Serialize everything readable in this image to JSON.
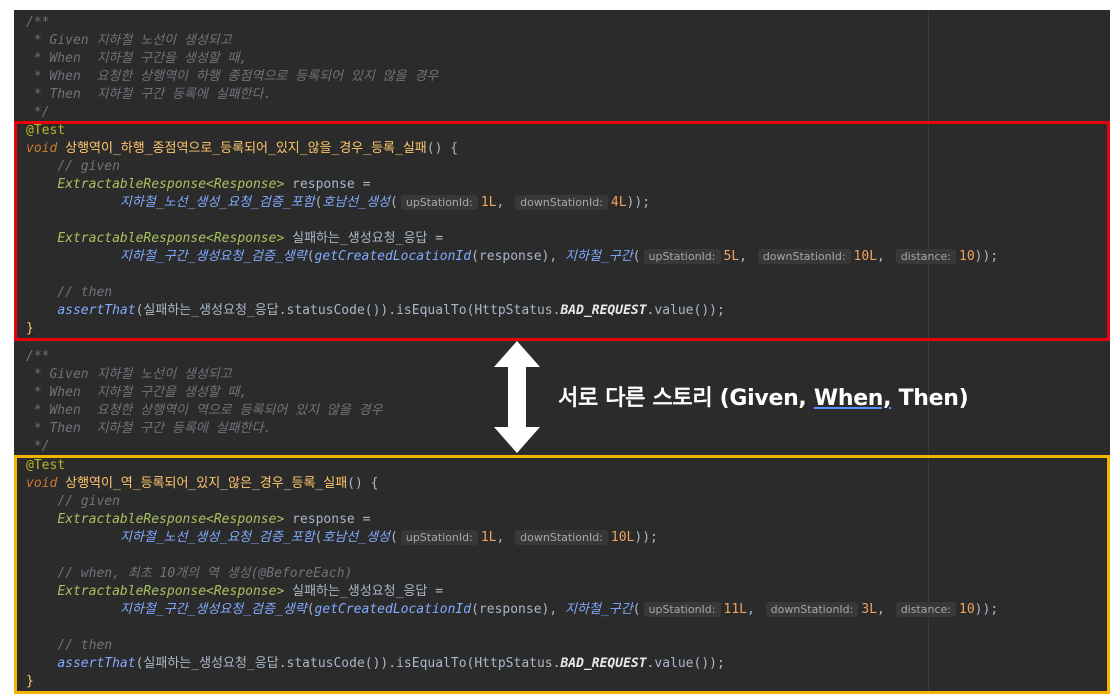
{
  "block1": {
    "doc": [
      "/**",
      " * Given 지하철 노선이 생성되고",
      " * When  지하철 구간을 생성할 때,",
      " * When  요청한 상행역이 하행 종점역으로 등록되어 있지 않을 경우",
      " * Then  지하철 구간 등록에 실패한다.",
      " */"
    ],
    "annotation": "@Test",
    "kw_void": "void",
    "method": "상행역이_하행_종점역으로_등록되어_있지_않을_경우_등록_실패",
    "sig_end": "() {",
    "c_given": "// given",
    "type1": "ExtractableResponse<Response>",
    "var1": " response =",
    "call1": "지하철_노선_생성_요청_검증_포함",
    "call1_inner": "호남선_생성",
    "h_up": "upStationId:",
    "v_up": "1L",
    "h_down": "downStationId:",
    "v_down": "4L",
    "type2": "ExtractableResponse<Response>",
    "var2": " 실패하는_생성요청_응답 =",
    "call2": "지하철_구간_생성요청_검증_생략",
    "call2_inner": "getCreatedLocationId",
    "arg_response": "response",
    "call2b": "지하철_구간",
    "h_up2": "upStationId:",
    "v_up2": "5L",
    "h_down2": "downStationId:",
    "v_down2": "10L",
    "h_dist": "distance:",
    "v_dist": "10",
    "c_then": "// then",
    "assert": "assertThat",
    "assert_arg": "실패하는_생성요청_응답",
    "status": ".statusCode()).isEqualTo(",
    "http": "HttpStatus.",
    "bad": "BAD_REQUEST",
    "val": ".value());",
    "close": "}"
  },
  "block2": {
    "doc": [
      "/**",
      " * Given 지하철 노선이 생성되고",
      " * When  지하철 구간을 생성할 때,",
      " * When  요청한 상행역이 역으로 등록되어 있지 않을 경우",
      " * Then  지하철 구간 등록에 실패한다.",
      " */"
    ],
    "annotation": "@Test",
    "kw_void": "void",
    "method": "상행역이_역_등록되어_있지_않은_경우_등록_실패",
    "sig_end": "() {",
    "c_given": "// given",
    "type1": "ExtractableResponse<Response>",
    "var1": " response =",
    "call1": "지하철_노선_생성_요청_검증_포함",
    "call1_inner": "호남선_생성",
    "h_up": "upStationId:",
    "v_up": "1L",
    "h_down": "downStationId:",
    "v_down": "10L",
    "c_when": "// when, 최초 10개의 역 생성(@BeforeEach)",
    "type2": "ExtractableResponse<Response>",
    "var2": " 실패하는_생성요청_응답 =",
    "call2": "지하철_구간_생성요청_검증_생략",
    "call2_inner": "getCreatedLocationId",
    "arg_response": "response",
    "call2b": "지하철_구간",
    "h_up2": "upStationId:",
    "v_up2": "11L",
    "h_down2": "downStationId:",
    "v_down2": "3L",
    "h_dist": "distance:",
    "v_dist": "10",
    "c_then": "// then",
    "assert": "assertThat",
    "assert_arg": "실패하는_생성요청_응답",
    "status": ".statusCode()).isEqualTo(",
    "http": "HttpStatus.",
    "bad": "BAD_REQUEST",
    "val": ".value());",
    "close": "}"
  },
  "caption": {
    "prefix": "서로 다른 스토리 (Given, ",
    "underlined": "When,",
    "suffix": " Then)"
  },
  "colors": {
    "editor_bg": "#2b2b2b",
    "box1": "#e8000b",
    "box2": "#f4b400",
    "comment": "#6f737a",
    "annotation": "#bbb529",
    "keyword": "#cc7832",
    "method": "#ffc66d",
    "number": "#f0a35e"
  },
  "icons": {
    "arrow": "double-vertical-arrow-icon"
  }
}
